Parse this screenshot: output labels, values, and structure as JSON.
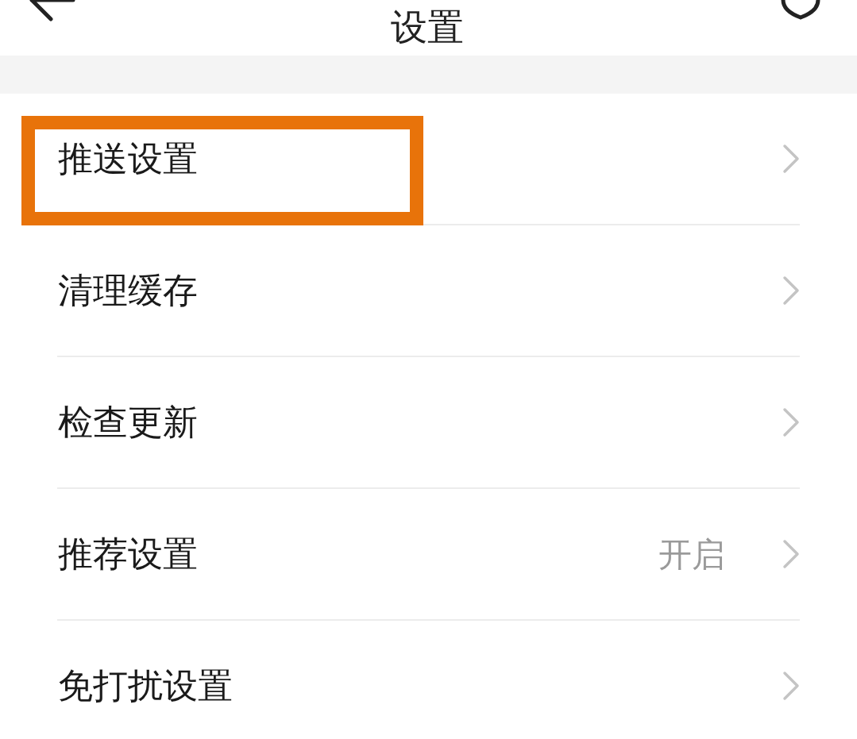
{
  "header": {
    "title": "设置"
  },
  "items": [
    {
      "label": "推送设置",
      "highlighted": true
    },
    {
      "label": "清理缓存",
      "highlighted": false
    },
    {
      "label": "检查更新",
      "highlighted": false
    },
    {
      "label": "推荐设置",
      "value": "开启",
      "highlighted": false
    },
    {
      "label": "免打扰设置",
      "highlighted": false
    }
  ]
}
